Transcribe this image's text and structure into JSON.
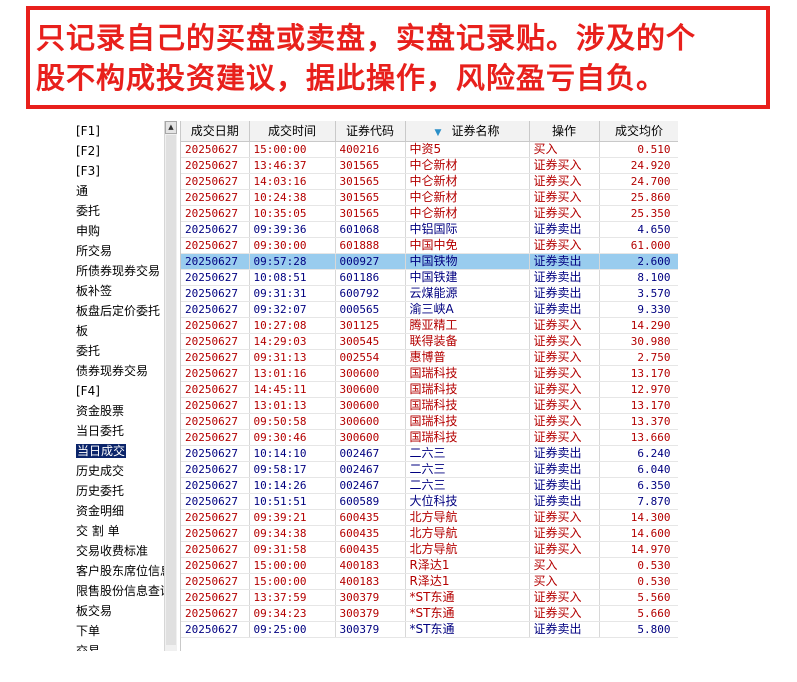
{
  "banner": {
    "line1": "只记录自己的买盘或卖盘，实盘记录贴。涉及的个",
    "line2": "股不构成投资建议，据此操作，风险盈亏自负。"
  },
  "sidebar": {
    "items": [
      "[F1]",
      "[F2]",
      "[F3]",
      "通",
      "委托",
      "申购",
      "所交易",
      "所债券现券交易",
      "板补签",
      "板盘后定价委托",
      "板",
      "委托",
      "债券现券交易",
      "[F4]",
      "资金股票",
      "当日委托",
      "当日成交",
      "历史成交",
      "历史委托",
      "资金明细",
      "交 割 单",
      "交易收费标准",
      "客户股东席位信息",
      "限售股份信息查询",
      "板交易",
      "下单",
      "交易"
    ],
    "selected_index": 16
  },
  "table": {
    "headers": [
      "成交日期",
      "成交时间",
      "证券代码",
      "证券名称",
      "操作",
      "成交均价"
    ],
    "rows": [
      {
        "date": "20250627",
        "time": "15:00:00",
        "code": "400216",
        "name": "中资5",
        "op": "买入",
        "price": "0.510",
        "side": "buy"
      },
      {
        "date": "20250627",
        "time": "13:46:37",
        "code": "301565",
        "name": "中仑新材",
        "op": "证券买入",
        "price": "24.920",
        "side": "buy"
      },
      {
        "date": "20250627",
        "time": "14:03:16",
        "code": "301565",
        "name": "中仑新材",
        "op": "证券买入",
        "price": "24.700",
        "side": "buy"
      },
      {
        "date": "20250627",
        "time": "10:24:38",
        "code": "301565",
        "name": "中仑新材",
        "op": "证券买入",
        "price": "25.860",
        "side": "buy"
      },
      {
        "date": "20250627",
        "time": "10:35:05",
        "code": "301565",
        "name": "中仑新材",
        "op": "证券买入",
        "price": "25.350",
        "side": "buy"
      },
      {
        "date": "20250627",
        "time": "09:39:36",
        "code": "601068",
        "name": "中铝国际",
        "op": "证券卖出",
        "price": "4.650",
        "side": "sell"
      },
      {
        "date": "20250627",
        "time": "09:30:00",
        "code": "601888",
        "name": "中国中免",
        "op": "证券买入",
        "price": "61.000",
        "side": "buy"
      },
      {
        "date": "20250627",
        "time": "09:57:28",
        "code": "000927",
        "name": "中国铁物",
        "op": "证券卖出",
        "price": "2.600",
        "side": "sel"
      },
      {
        "date": "20250627",
        "time": "10:08:51",
        "code": "601186",
        "name": "中国铁建",
        "op": "证券卖出",
        "price": "8.100",
        "side": "sell"
      },
      {
        "date": "20250627",
        "time": "09:31:31",
        "code": "600792",
        "name": "云煤能源",
        "op": "证券卖出",
        "price": "3.570",
        "side": "sell"
      },
      {
        "date": "20250627",
        "time": "09:32:07",
        "code": "000565",
        "name": "渝三峡A",
        "op": "证券卖出",
        "price": "9.330",
        "side": "sell"
      },
      {
        "date": "20250627",
        "time": "10:27:08",
        "code": "301125",
        "name": "腾亚精工",
        "op": "证券买入",
        "price": "14.290",
        "side": "buy"
      },
      {
        "date": "20250627",
        "time": "14:29:03",
        "code": "300545",
        "name": "联得装备",
        "op": "证券买入",
        "price": "30.980",
        "side": "buy"
      },
      {
        "date": "20250627",
        "time": "09:31:13",
        "code": "002554",
        "name": "惠博普",
        "op": "证券买入",
        "price": "2.750",
        "side": "buy"
      },
      {
        "date": "20250627",
        "time": "13:01:16",
        "code": "300600",
        "name": "国瑞科技",
        "op": "证券买入",
        "price": "13.170",
        "side": "buy"
      },
      {
        "date": "20250627",
        "time": "14:45:11",
        "code": "300600",
        "name": "国瑞科技",
        "op": "证券买入",
        "price": "12.970",
        "side": "buy"
      },
      {
        "date": "20250627",
        "time": "13:01:13",
        "code": "300600",
        "name": "国瑞科技",
        "op": "证券买入",
        "price": "13.170",
        "side": "buy"
      },
      {
        "date": "20250627",
        "time": "09:50:58",
        "code": "300600",
        "name": "国瑞科技",
        "op": "证券买入",
        "price": "13.370",
        "side": "buy"
      },
      {
        "date": "20250627",
        "time": "09:30:46",
        "code": "300600",
        "name": "国瑞科技",
        "op": "证券买入",
        "price": "13.660",
        "side": "buy"
      },
      {
        "date": "20250627",
        "time": "10:14:10",
        "code": "002467",
        "name": "二六三",
        "op": "证券卖出",
        "price": "6.240",
        "side": "sell"
      },
      {
        "date": "20250627",
        "time": "09:58:17",
        "code": "002467",
        "name": "二六三",
        "op": "证券卖出",
        "price": "6.040",
        "side": "sell"
      },
      {
        "date": "20250627",
        "time": "10:14:26",
        "code": "002467",
        "name": "二六三",
        "op": "证券卖出",
        "price": "6.350",
        "side": "sell"
      },
      {
        "date": "20250627",
        "time": "10:51:51",
        "code": "600589",
        "name": "大位科技",
        "op": "证券卖出",
        "price": "7.870",
        "side": "sell"
      },
      {
        "date": "20250627",
        "time": "09:39:21",
        "code": "600435",
        "name": "北方导航",
        "op": "证券买入",
        "price": "14.300",
        "side": "buy"
      },
      {
        "date": "20250627",
        "time": "09:34:38",
        "code": "600435",
        "name": "北方导航",
        "op": "证券买入",
        "price": "14.600",
        "side": "buy"
      },
      {
        "date": "20250627",
        "time": "09:31:58",
        "code": "600435",
        "name": "北方导航",
        "op": "证券买入",
        "price": "14.970",
        "side": "buy"
      },
      {
        "date": "20250627",
        "time": "15:00:00",
        "code": "400183",
        "name": "R泽达1",
        "op": "买入",
        "price": "0.530",
        "side": "buy"
      },
      {
        "date": "20250627",
        "time": "15:00:00",
        "code": "400183",
        "name": "R泽达1",
        "op": "买入",
        "price": "0.530",
        "side": "buy"
      },
      {
        "date": "20250627",
        "time": "13:37:59",
        "code": "300379",
        "name": "*ST东通",
        "op": "证券买入",
        "price": "5.560",
        "side": "buy"
      },
      {
        "date": "20250627",
        "time": "09:34:23",
        "code": "300379",
        "name": "*ST东通",
        "op": "证券买入",
        "price": "5.660",
        "side": "buy"
      },
      {
        "date": "20250627",
        "time": "09:25:00",
        "code": "300379",
        "name": "*ST东通",
        "op": "证券卖出",
        "price": "5.800",
        "side": "sell"
      }
    ]
  },
  "colors": {
    "banner_red": "#e8201c",
    "buy": "#b40000",
    "sell": "#000080",
    "selected_row": "#99ccee"
  }
}
